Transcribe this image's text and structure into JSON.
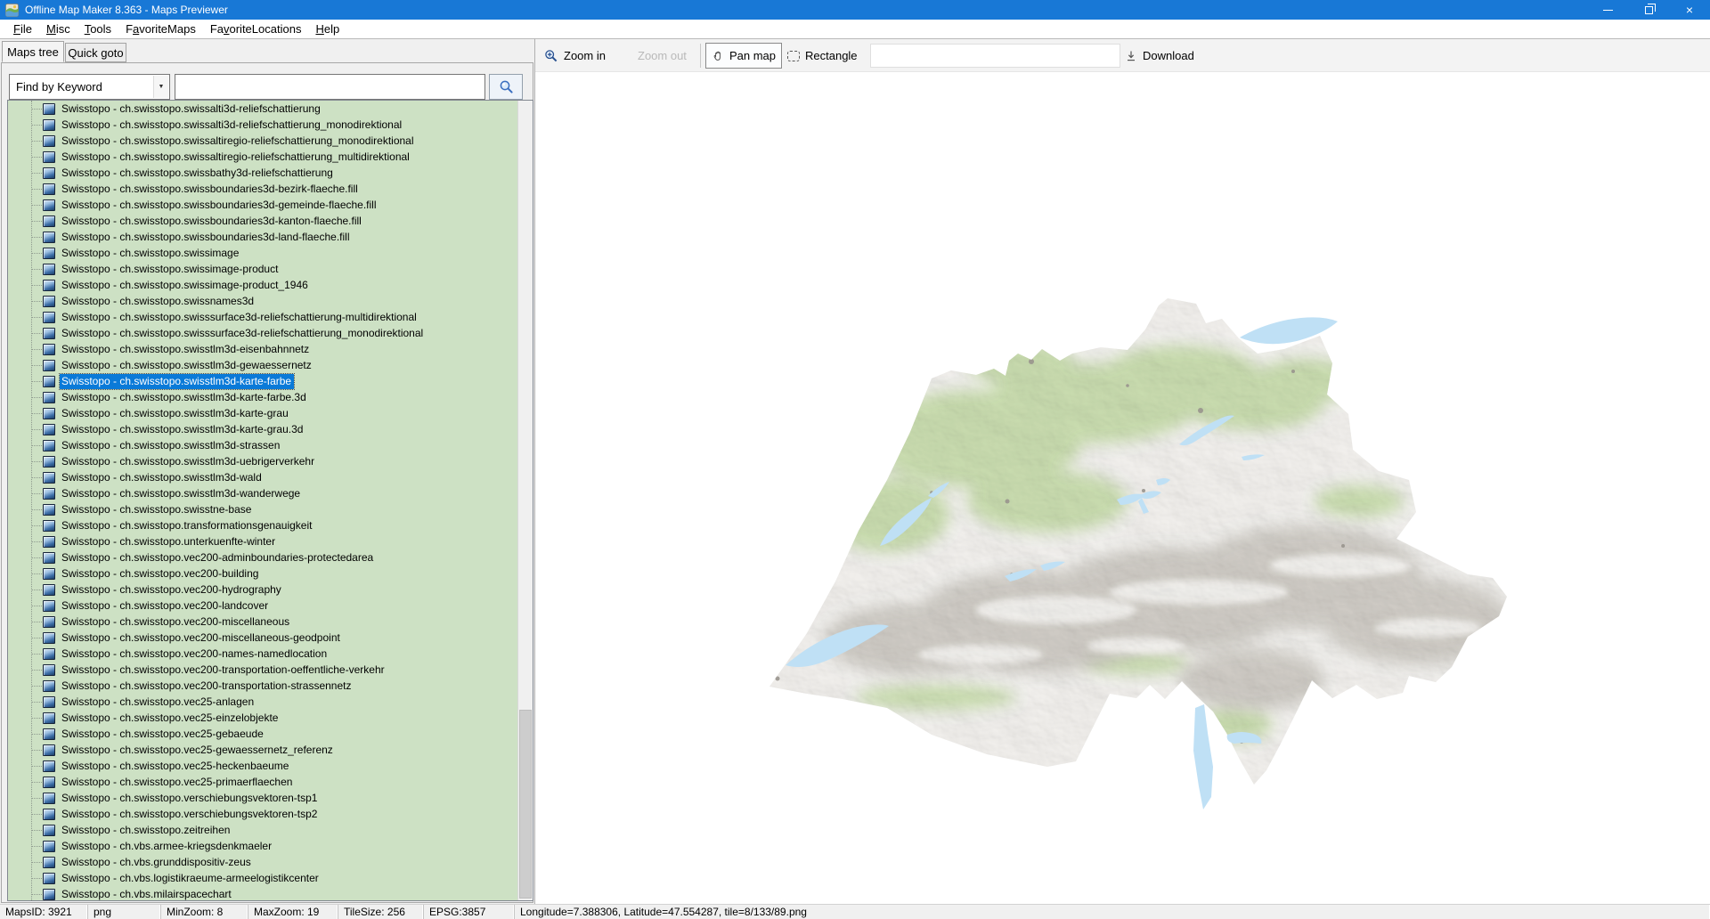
{
  "window": {
    "title": "Offline Map Maker 8.363 - Maps Previewer",
    "controls": {
      "minimize": "minimize",
      "restore": "restore",
      "close": "close"
    }
  },
  "menu": {
    "items": [
      {
        "label": "File",
        "accel_index": 0
      },
      {
        "label": "Misc",
        "accel_index": 0
      },
      {
        "label": "Tools",
        "accel_index": 0
      },
      {
        "label": "FavoriteMaps",
        "accel_index": 1
      },
      {
        "label": "FavoriteLocations",
        "accel_index": 2
      },
      {
        "label": "Help",
        "accel_index": 0
      }
    ]
  },
  "tabs": {
    "maps_tree": "Maps tree",
    "quick_goto": "Quick goto"
  },
  "search": {
    "filter_selected": "Find by Keyword",
    "query_value": "",
    "query_placeholder": "",
    "button_icon": "magnifier-icon"
  },
  "maps_tree": {
    "selected_index": 17,
    "items": [
      "Swisstopo - ch.swisstopo.swissalti3d-reliefschattierung",
      "Swisstopo - ch.swisstopo.swissalti3d-reliefschattierung_monodirektional",
      "Swisstopo - ch.swisstopo.swissaltiregio-reliefschattierung_monodirektional",
      "Swisstopo - ch.swisstopo.swissaltiregio-reliefschattierung_multidirektional",
      "Swisstopo - ch.swisstopo.swissbathy3d-reliefschattierung",
      "Swisstopo - ch.swisstopo.swissboundaries3d-bezirk-flaeche.fill",
      "Swisstopo - ch.swisstopo.swissboundaries3d-gemeinde-flaeche.fill",
      "Swisstopo - ch.swisstopo.swissboundaries3d-kanton-flaeche.fill",
      "Swisstopo - ch.swisstopo.swissboundaries3d-land-flaeche.fill",
      "Swisstopo - ch.swisstopo.swissimage",
      "Swisstopo - ch.swisstopo.swissimage-product",
      "Swisstopo - ch.swisstopo.swissimage-product_1946",
      "Swisstopo - ch.swisstopo.swissnames3d",
      "Swisstopo - ch.swisstopo.swisssurface3d-reliefschattierung-multidirektional",
      "Swisstopo - ch.swisstopo.swisssurface3d-reliefschattierung_monodirektional",
      "Swisstopo - ch.swisstopo.swisstlm3d-eisenbahnnetz",
      "Swisstopo - ch.swisstopo.swisstlm3d-gewaessernetz",
      "Swisstopo - ch.swisstopo.swisstlm3d-karte-farbe",
      "Swisstopo - ch.swisstopo.swisstlm3d-karte-farbe.3d",
      "Swisstopo - ch.swisstopo.swisstlm3d-karte-grau",
      "Swisstopo - ch.swisstopo.swisstlm3d-karte-grau.3d",
      "Swisstopo - ch.swisstopo.swisstlm3d-strassen",
      "Swisstopo - ch.swisstopo.swisstlm3d-uebrigerverkehr",
      "Swisstopo - ch.swisstopo.swisstlm3d-wald",
      "Swisstopo - ch.swisstopo.swisstlm3d-wanderwege",
      "Swisstopo - ch.swisstopo.swisstne-base",
      "Swisstopo - ch.swisstopo.transformationsgenauigkeit",
      "Swisstopo - ch.swisstopo.unterkuenfte-winter",
      "Swisstopo - ch.swisstopo.vec200-adminboundaries-protectedarea",
      "Swisstopo - ch.swisstopo.vec200-building",
      "Swisstopo - ch.swisstopo.vec200-hydrography",
      "Swisstopo - ch.swisstopo.vec200-landcover",
      "Swisstopo - ch.swisstopo.vec200-miscellaneous",
      "Swisstopo - ch.swisstopo.vec200-miscellaneous-geodpoint",
      "Swisstopo - ch.swisstopo.vec200-names-namedlocation",
      "Swisstopo - ch.swisstopo.vec200-transportation-oeffentliche-verkehr",
      "Swisstopo - ch.swisstopo.vec200-transportation-strassennetz",
      "Swisstopo - ch.swisstopo.vec25-anlagen",
      "Swisstopo - ch.swisstopo.vec25-einzelobjekte",
      "Swisstopo - ch.swisstopo.vec25-gebaeude",
      "Swisstopo - ch.swisstopo.vec25-gewaessernetz_referenz",
      "Swisstopo - ch.swisstopo.vec25-heckenbaeume",
      "Swisstopo - ch.swisstopo.vec25-primaerflaechen",
      "Swisstopo - ch.swisstopo.verschiebungsvektoren-tsp1",
      "Swisstopo - ch.swisstopo.verschiebungsvektoren-tsp2",
      "Swisstopo - ch.swisstopo.zeitreihen",
      "Swisstopo - ch.vbs.armee-kriegsdenkmaeler",
      "Swisstopo - ch.vbs.grunddispositiv-zeus",
      "Swisstopo - ch.vbs.logistikraeume-armeelogistikcenter",
      "Swisstopo - ch.vbs.milairspacechart"
    ]
  },
  "toolbar": {
    "zoom_in": "Zoom in",
    "zoom_out": "Zoom out",
    "pan_map": "Pan map",
    "rectangle": "Rectangle",
    "input_value": "",
    "download": "Download",
    "active_tool": "Pan map"
  },
  "statusbar": {
    "maps_id": "MapsID: 3921",
    "format": "png",
    "min_zoom": "MinZoom: 8",
    "max_zoom": "MaxZoom: 19",
    "tile_size": "TileSize: 256",
    "epsg": "EPSG:3857",
    "position": "Longitude=7.388306, Latitude=47.554287, tile=8/133/89.png"
  },
  "map": {
    "description": "Topographic relief preview of Switzerland on white background",
    "colors": {
      "selection": "#0a7ad8",
      "list_background": "#cde1c4",
      "titlebar": "#1878d6",
      "land_base": "#e8e6e1",
      "vegetation_green": "#c2d9a4",
      "alpine_gray": "#c6c2bb",
      "lake_blue": "#bfe0f5"
    }
  }
}
